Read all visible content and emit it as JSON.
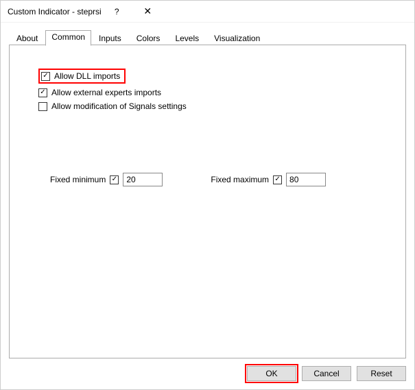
{
  "window": {
    "title": "Custom Indicator - steprsi"
  },
  "tabs": {
    "list": [
      {
        "label": "About"
      },
      {
        "label": "Common"
      },
      {
        "label": "Inputs"
      },
      {
        "label": "Colors"
      },
      {
        "label": "Levels"
      },
      {
        "label": "Visualization"
      }
    ],
    "active_index": 1
  },
  "options": {
    "allow_dll_imports": {
      "label": "Allow DLL imports",
      "checked": true
    },
    "allow_external_experts": {
      "label": "Allow external experts imports",
      "checked": true
    },
    "allow_signals_modify": {
      "label": "Allow modification of Signals settings",
      "checked": false
    }
  },
  "fixed": {
    "min_label": "Fixed minimum",
    "min_checked": true,
    "min_value": "20",
    "max_label": "Fixed maximum",
    "max_checked": true,
    "max_value": "80"
  },
  "buttons": {
    "ok": "OK",
    "cancel": "Cancel",
    "reset": "Reset"
  },
  "highlights": {
    "color": "#ff0000"
  }
}
